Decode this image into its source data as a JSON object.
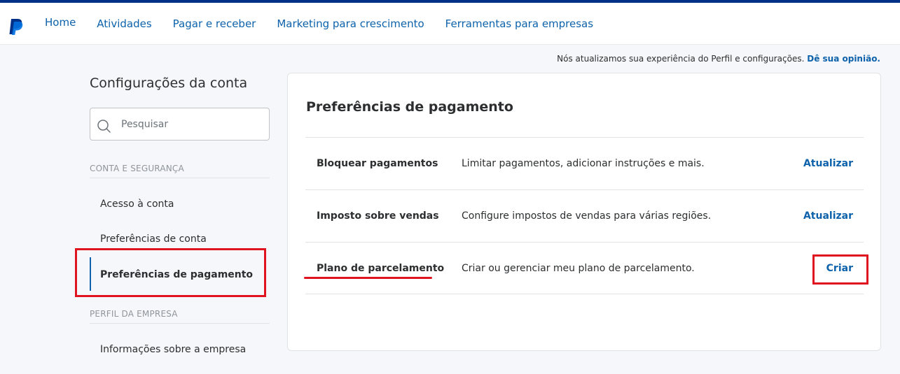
{
  "topnav": {
    "items": [
      "Home",
      "Atividades",
      "Pagar e receber",
      "Marketing para crescimento",
      "Ferramentas para empresas"
    ]
  },
  "notice": {
    "text": "Nós atualizamos sua experiência do Perfil e configurações.",
    "link": "Dê sua opinião."
  },
  "sidebar": {
    "title": "Configurações da conta",
    "search_placeholder": "Pesquisar",
    "sections": [
      {
        "label": "CONTA E SEGURANÇA",
        "items": [
          "Acesso à conta",
          "Preferências de conta",
          "Preferências de pagamento"
        ]
      },
      {
        "label": "PERFIL DA EMPRESA",
        "items": [
          "Informações sobre a empresa"
        ]
      }
    ],
    "active_item": "Preferências de pagamento"
  },
  "main": {
    "title": "Preferências de pagamento",
    "rows": [
      {
        "name": "Bloquear pagamentos",
        "description": "Limitar pagamentos, adicionar instruções e mais.",
        "action": "Atualizar"
      },
      {
        "name": "Imposto sobre vendas",
        "description": "Configure impostos de vendas para várias regiões.",
        "action": "Atualizar"
      },
      {
        "name": "Plano de parcelamento",
        "description": "Criar ou gerenciar meu plano de parcelamento.",
        "action": "Criar"
      }
    ]
  },
  "colors": {
    "brand_dark": "#003087",
    "link": "#0d62ab",
    "highlight": "#e0141e"
  }
}
